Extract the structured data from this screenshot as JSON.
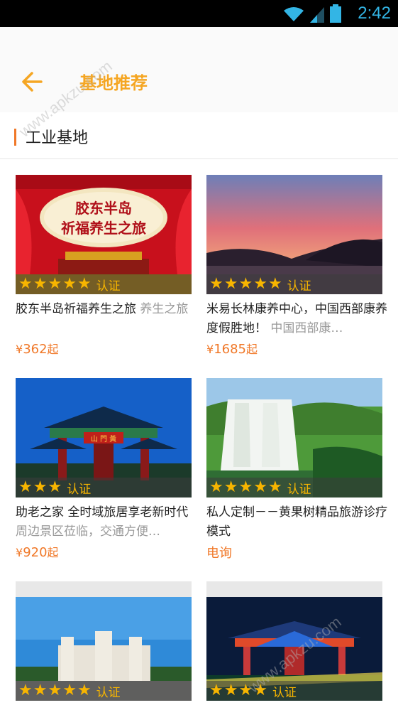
{
  "status_bar": {
    "time": "2:42"
  },
  "header": {
    "title": "基地推荐"
  },
  "section": {
    "title": "工业基地"
  },
  "watermark": "www.apkzu.com",
  "cards": [
    {
      "title": "胶东半岛祈福养生之旅",
      "subtitle": "养生之旅",
      "price_prefix": "¥",
      "price": "362",
      "price_suffix": "起",
      "stars": 5,
      "cert": "认证",
      "banner_line1": "胶东半岛",
      "banner_line2": "祈福养生之旅"
    },
    {
      "title": "米易长林康养中心，中国西部康养度假胜地！",
      "subtitle": "中国西部康…",
      "price_prefix": "¥",
      "price": "1685",
      "price_suffix": "起",
      "stars": 5,
      "cert": "认证"
    },
    {
      "title": "助老之家 全时域旅居享老新时代",
      "subtitle": "周边景区莅临，交通方便…",
      "price_prefix": "¥",
      "price": "920",
      "price_suffix": "起",
      "stars": 3,
      "cert": "认证",
      "gate_sign": "山 門 黃"
    },
    {
      "title": "私人定制－－黄果树精品旅游诊疗模式",
      "subtitle": "",
      "price_prefix": "",
      "price": "电询",
      "price_suffix": "",
      "stars": 5,
      "cert": "认证"
    },
    {
      "title": "",
      "subtitle": "",
      "price_prefix": "",
      "price": "",
      "price_suffix": "",
      "stars": 5,
      "cert": "认证"
    },
    {
      "title": "",
      "subtitle": "",
      "price_prefix": "",
      "price": "",
      "price_suffix": "",
      "stars": 4,
      "cert": "认证"
    }
  ]
}
